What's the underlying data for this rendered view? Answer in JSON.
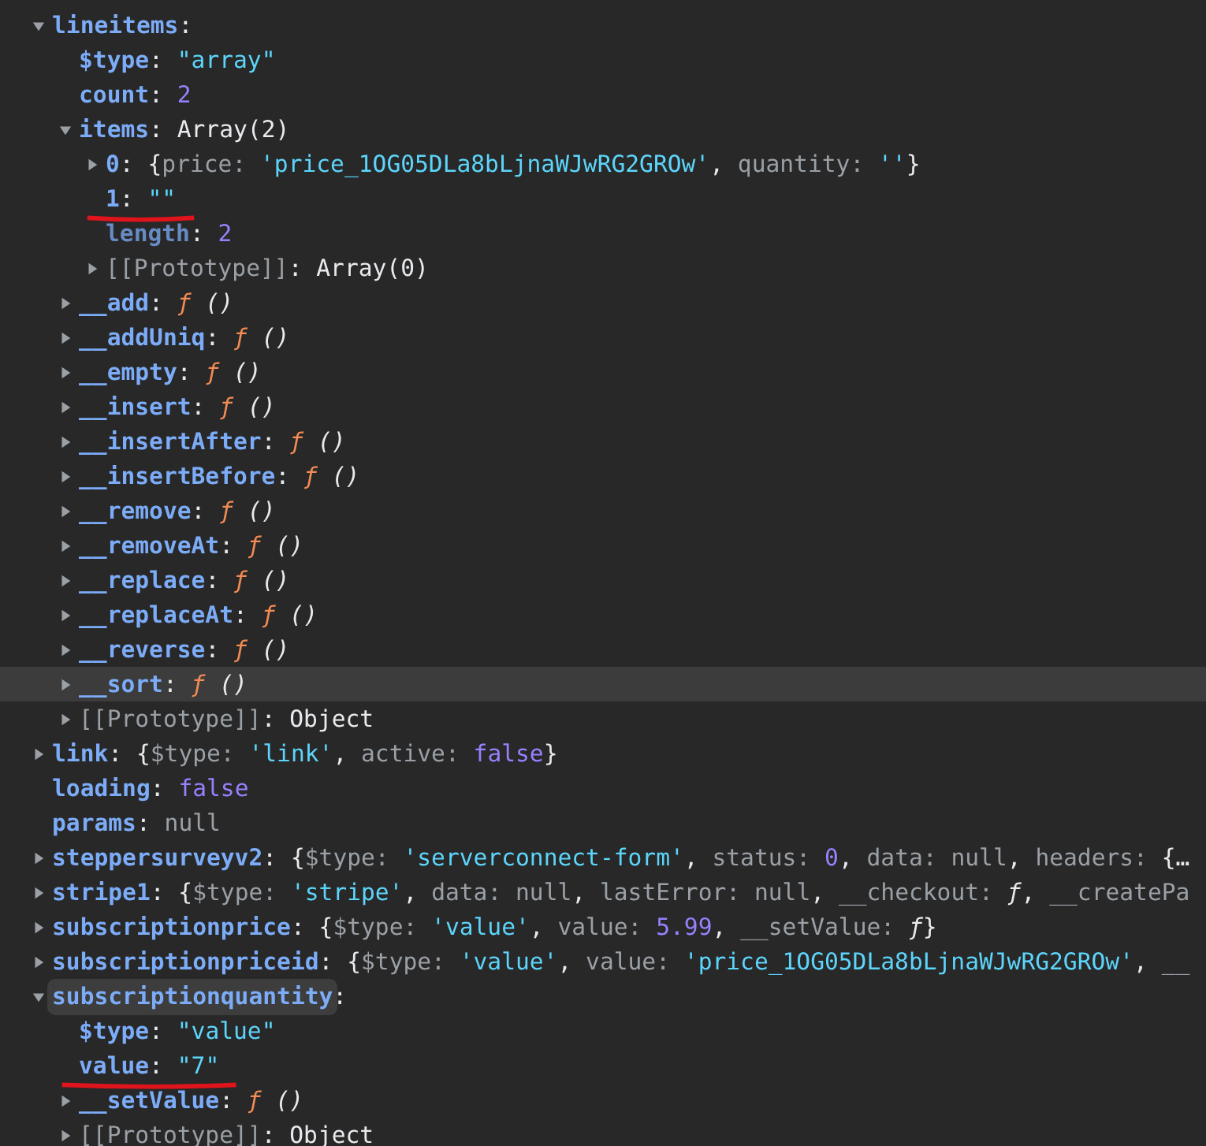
{
  "tree": [
    {
      "key": "lineitems",
      "kind": "own",
      "expanded": true,
      "hovered": false,
      "focused": false,
      "underlined": false,
      "value": [
        {
          "kind": "punct",
          "text": ":"
        }
      ],
      "children": [
        {
          "key": "$type",
          "kind": "own",
          "hovered": false,
          "focused": false,
          "underlined": false,
          "value": [
            {
              "kind": "punct",
              "text": ": "
            },
            {
              "kind": "string",
              "text": "\"array\""
            }
          ]
        },
        {
          "key": "count",
          "kind": "own",
          "hovered": false,
          "focused": false,
          "underlined": false,
          "value": [
            {
              "kind": "punct",
              "text": ": "
            },
            {
              "kind": "number",
              "text": "2"
            }
          ]
        },
        {
          "key": "items",
          "kind": "own",
          "expanded": true,
          "hovered": false,
          "focused": false,
          "underlined": false,
          "value": [
            {
              "kind": "punct",
              "text": ": Array(2)"
            }
          ],
          "children": [
            {
              "key": "0",
              "kind": "own",
              "expanded": false,
              "hovered": false,
              "focused": false,
              "underlined": false,
              "value": [
                {
                  "kind": "punct",
                  "text": ": {"
                },
                {
                  "kind": "grey",
                  "text": "price: "
                },
                {
                  "kind": "string",
                  "text": "'price_1OG05DLa8bLjnaWJwRG2GROw'"
                },
                {
                  "kind": "punct",
                  "text": ", "
                },
                {
                  "kind": "grey",
                  "text": "quantity: "
                },
                {
                  "kind": "string",
                  "text": "''"
                },
                {
                  "kind": "punct",
                  "text": "}"
                }
              ]
            },
            {
              "key": "1",
              "kind": "own",
              "hovered": false,
              "focused": false,
              "underlined": true,
              "value": [
                {
                  "kind": "punct",
                  "text": ": "
                },
                {
                  "kind": "string",
                  "text": "\"\""
                }
              ]
            },
            {
              "key": "length",
              "kind": "hidden",
              "hovered": false,
              "focused": false,
              "underlined": false,
              "value": [
                {
                  "kind": "punct",
                  "text": ": "
                },
                {
                  "kind": "number",
                  "text": "2"
                }
              ]
            },
            {
              "key": "[[Prototype]]",
              "kind": "internal",
              "expanded": false,
              "hovered": false,
              "focused": false,
              "underlined": false,
              "value": [
                {
                  "kind": "punct",
                  "text": ": Array(0)"
                }
              ]
            }
          ]
        },
        {
          "key": "__add",
          "kind": "own",
          "expanded": false,
          "hovered": false,
          "focused": false,
          "underlined": false,
          "value": [
            {
              "kind": "punct",
              "text": ": "
            },
            {
              "kind": "func",
              "text": "ƒ"
            },
            {
              "kind": "italic",
              "text": " ()"
            }
          ]
        },
        {
          "key": "__addUniq",
          "kind": "own",
          "expanded": false,
          "hovered": false,
          "focused": false,
          "underlined": false,
          "value": [
            {
              "kind": "punct",
              "text": ": "
            },
            {
              "kind": "func",
              "text": "ƒ"
            },
            {
              "kind": "italic",
              "text": " ()"
            }
          ]
        },
        {
          "key": "__empty",
          "kind": "own",
          "expanded": false,
          "hovered": false,
          "focused": false,
          "underlined": false,
          "value": [
            {
              "kind": "punct",
              "text": ": "
            },
            {
              "kind": "func",
              "text": "ƒ"
            },
            {
              "kind": "italic",
              "text": " ()"
            }
          ]
        },
        {
          "key": "__insert",
          "kind": "own",
          "expanded": false,
          "hovered": false,
          "focused": false,
          "underlined": false,
          "value": [
            {
              "kind": "punct",
              "text": ": "
            },
            {
              "kind": "func",
              "text": "ƒ"
            },
            {
              "kind": "italic",
              "text": " ()"
            }
          ]
        },
        {
          "key": "__insertAfter",
          "kind": "own",
          "expanded": false,
          "hovered": false,
          "focused": false,
          "underlined": false,
          "value": [
            {
              "kind": "punct",
              "text": ": "
            },
            {
              "kind": "func",
              "text": "ƒ"
            },
            {
              "kind": "italic",
              "text": " ()"
            }
          ]
        },
        {
          "key": "__insertBefore",
          "kind": "own",
          "expanded": false,
          "hovered": false,
          "focused": false,
          "underlined": false,
          "value": [
            {
              "kind": "punct",
              "text": ": "
            },
            {
              "kind": "func",
              "text": "ƒ"
            },
            {
              "kind": "italic",
              "text": " ()"
            }
          ]
        },
        {
          "key": "__remove",
          "kind": "own",
          "expanded": false,
          "hovered": false,
          "focused": false,
          "underlined": false,
          "value": [
            {
              "kind": "punct",
              "text": ": "
            },
            {
              "kind": "func",
              "text": "ƒ"
            },
            {
              "kind": "italic",
              "text": " ()"
            }
          ]
        },
        {
          "key": "__removeAt",
          "kind": "own",
          "expanded": false,
          "hovered": false,
          "focused": false,
          "underlined": false,
          "value": [
            {
              "kind": "punct",
              "text": ": "
            },
            {
              "kind": "func",
              "text": "ƒ"
            },
            {
              "kind": "italic",
              "text": " ()"
            }
          ]
        },
        {
          "key": "__replace",
          "kind": "own",
          "expanded": false,
          "hovered": false,
          "focused": false,
          "underlined": false,
          "value": [
            {
              "kind": "punct",
              "text": ": "
            },
            {
              "kind": "func",
              "text": "ƒ"
            },
            {
              "kind": "italic",
              "text": " ()"
            }
          ]
        },
        {
          "key": "__replaceAt",
          "kind": "own",
          "expanded": false,
          "hovered": false,
          "focused": false,
          "underlined": false,
          "value": [
            {
              "kind": "punct",
              "text": ": "
            },
            {
              "kind": "func",
              "text": "ƒ"
            },
            {
              "kind": "italic",
              "text": " ()"
            }
          ]
        },
        {
          "key": "__reverse",
          "kind": "own",
          "expanded": false,
          "hovered": false,
          "focused": false,
          "underlined": false,
          "value": [
            {
              "kind": "punct",
              "text": ": "
            },
            {
              "kind": "func",
              "text": "ƒ"
            },
            {
              "kind": "italic",
              "text": " ()"
            }
          ]
        },
        {
          "key": "__sort",
          "kind": "own",
          "expanded": false,
          "hovered": true,
          "focused": false,
          "underlined": false,
          "value": [
            {
              "kind": "punct",
              "text": ": "
            },
            {
              "kind": "func",
              "text": "ƒ"
            },
            {
              "kind": "italic",
              "text": " ()"
            }
          ]
        },
        {
          "key": "[[Prototype]]",
          "kind": "internal",
          "expanded": false,
          "hovered": false,
          "focused": false,
          "underlined": false,
          "value": [
            {
              "kind": "punct",
              "text": ": Object"
            }
          ]
        }
      ]
    },
    {
      "key": "link",
      "kind": "own",
      "expanded": false,
      "hovered": false,
      "focused": false,
      "underlined": false,
      "value": [
        {
          "kind": "punct",
          "text": ": {"
        },
        {
          "kind": "grey",
          "text": "$type: "
        },
        {
          "kind": "string",
          "text": "'link'"
        },
        {
          "kind": "punct",
          "text": ", "
        },
        {
          "kind": "grey",
          "text": "active: "
        },
        {
          "kind": "number",
          "text": "false"
        },
        {
          "kind": "punct",
          "text": "}"
        }
      ]
    },
    {
      "key": "loading",
      "kind": "own",
      "hovered": false,
      "focused": false,
      "underlined": false,
      "value": [
        {
          "kind": "punct",
          "text": ": "
        },
        {
          "kind": "number",
          "text": "false"
        }
      ]
    },
    {
      "key": "params",
      "kind": "own",
      "hovered": false,
      "focused": false,
      "underlined": false,
      "value": [
        {
          "kind": "punct",
          "text": ": "
        },
        {
          "kind": "grey",
          "text": "null"
        }
      ]
    },
    {
      "key": "steppersurveyv2",
      "kind": "own",
      "expanded": false,
      "hovered": false,
      "focused": false,
      "underlined": false,
      "value": [
        {
          "kind": "punct",
          "text": ": {"
        },
        {
          "kind": "grey",
          "text": "$type: "
        },
        {
          "kind": "string",
          "text": "'serverconnect-form'"
        },
        {
          "kind": "punct",
          "text": ", "
        },
        {
          "kind": "grey",
          "text": "status: "
        },
        {
          "kind": "number",
          "text": "0"
        },
        {
          "kind": "punct",
          "text": ", "
        },
        {
          "kind": "grey",
          "text": "data: null"
        },
        {
          "kind": "punct",
          "text": ", "
        },
        {
          "kind": "grey",
          "text": "headers: "
        },
        {
          "kind": "punct",
          "text": "{…"
        }
      ]
    },
    {
      "key": "stripe1",
      "kind": "own",
      "expanded": false,
      "hovered": false,
      "focused": false,
      "underlined": false,
      "value": [
        {
          "kind": "punct",
          "text": ": {"
        },
        {
          "kind": "grey",
          "text": "$type: "
        },
        {
          "kind": "string",
          "text": "'stripe'"
        },
        {
          "kind": "punct",
          "text": ", "
        },
        {
          "kind": "grey",
          "text": "data: null"
        },
        {
          "kind": "punct",
          "text": ", "
        },
        {
          "kind": "grey",
          "text": "lastError: null"
        },
        {
          "kind": "punct",
          "text": ", "
        },
        {
          "kind": "grey",
          "text": "__checkout: "
        },
        {
          "kind": "italic",
          "text": "ƒ"
        },
        {
          "kind": "punct",
          "text": ", "
        },
        {
          "kind": "grey",
          "text": "__createPa"
        }
      ]
    },
    {
      "key": "subscriptionprice",
      "kind": "own",
      "expanded": false,
      "hovered": false,
      "focused": false,
      "underlined": false,
      "value": [
        {
          "kind": "punct",
          "text": ": {"
        },
        {
          "kind": "grey",
          "text": "$type: "
        },
        {
          "kind": "string",
          "text": "'value'"
        },
        {
          "kind": "punct",
          "text": ", "
        },
        {
          "kind": "grey",
          "text": "value: "
        },
        {
          "kind": "number",
          "text": "5.99"
        },
        {
          "kind": "punct",
          "text": ", "
        },
        {
          "kind": "grey",
          "text": "__setValue: "
        },
        {
          "kind": "italic",
          "text": "ƒ"
        },
        {
          "kind": "punct",
          "text": "}"
        }
      ]
    },
    {
      "key": "subscriptionpriceid",
      "kind": "own",
      "expanded": false,
      "hovered": false,
      "focused": false,
      "underlined": false,
      "value": [
        {
          "kind": "punct",
          "text": ": {"
        },
        {
          "kind": "grey",
          "text": "$type: "
        },
        {
          "kind": "string",
          "text": "'value'"
        },
        {
          "kind": "punct",
          "text": ", "
        },
        {
          "kind": "grey",
          "text": "value: "
        },
        {
          "kind": "string",
          "text": "'price_1OG05DLa8bLjnaWJwRG2GROw'"
        },
        {
          "kind": "punct",
          "text": ", "
        },
        {
          "kind": "grey",
          "text": "__"
        }
      ]
    },
    {
      "key": "subscriptionquantity",
      "kind": "own",
      "expanded": true,
      "hovered": false,
      "focused": true,
      "underlined": false,
      "value": [
        {
          "kind": "punct",
          "text": ":"
        }
      ],
      "children": [
        {
          "key": "$type",
          "kind": "own",
          "hovered": false,
          "focused": false,
          "underlined": false,
          "value": [
            {
              "kind": "punct",
              "text": ": "
            },
            {
              "kind": "string",
              "text": "\"value\""
            }
          ]
        },
        {
          "key": "value",
          "kind": "own",
          "hovered": false,
          "focused": false,
          "underlined": true,
          "value": [
            {
              "kind": "punct",
              "text": ": "
            },
            {
              "kind": "string",
              "text": "\"7\""
            }
          ]
        },
        {
          "key": "__setValue",
          "kind": "own",
          "expanded": false,
          "hovered": false,
          "focused": false,
          "underlined": false,
          "value": [
            {
              "kind": "punct",
              "text": ": "
            },
            {
              "kind": "func",
              "text": "ƒ"
            },
            {
              "kind": "italic",
              "text": " ()"
            }
          ]
        },
        {
          "key": "[[Prototype]]",
          "kind": "internal",
          "expanded": false,
          "hovered": false,
          "focused": false,
          "underlined": false,
          "value": [
            {
              "kind": "punct",
              "text": ": Object"
            }
          ]
        }
      ]
    }
  ]
}
